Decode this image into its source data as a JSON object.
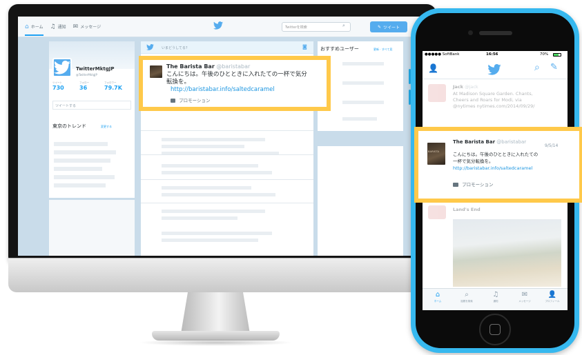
{
  "colors": {
    "twitter_blue": "#55acee",
    "highlight": "#ffc94a",
    "phone_case": "#36b8ef"
  },
  "desktop": {
    "nav": {
      "home": "ホーム",
      "notifications": "通知",
      "messages": "メッセージ"
    },
    "search_placeholder": "Twitterを検索",
    "tweet_button": "ツイート",
    "profile": {
      "name": "TwitterMktgJP",
      "handle": "@TwitterMktgJP",
      "stats": [
        {
          "label": "ツイート",
          "value": "730"
        },
        {
          "label": "フォロー",
          "value": "36"
        },
        {
          "label": "フォロワー",
          "value": "79.7K"
        }
      ],
      "compose_placeholder": "ツイートする"
    },
    "trends": {
      "title": "東京のトレンド",
      "change": "変更する"
    },
    "compose": {
      "placeholder": "いまどうしてる?"
    },
    "who_to_follow": {
      "title": "おすすめユーザー",
      "links": "更新 · すべて見"
    },
    "promo": {
      "name": "The Barista Bar",
      "handle": "@baristabar",
      "text": "こんにちは。午後のひとときに入れたての一杯で気分転換を。",
      "link": "http://baristabar.info/saltedcaramel",
      "label": "プロモーション"
    }
  },
  "phone": {
    "status": {
      "carrier": "●●●●● SoftBank",
      "time": "16:56",
      "battery": "70%"
    },
    "faded_tweet": {
      "name": "Jack",
      "handle": "@jack",
      "line1": "At Madison Square Garden. Chants,",
      "line2": "Cheers and Roars for Modi, via",
      "line3": "@nytimes nytimes.com/2014/09/29/"
    },
    "promo": {
      "name": "The Barista Bar",
      "handle": "@baristabar",
      "date": "9/5/14",
      "line1": "こんにちは。午後のひとときに入れたての",
      "line2": "一杯で気分転換を。",
      "link": "http://baristabar.info/saltedcaramel",
      "label": "プロモーション",
      "thumb_text": "BARISTA"
    },
    "faded_tweet2": {
      "name": "Land's End"
    },
    "tabs": [
      {
        "label": "ホーム"
      },
      {
        "label": "話題を検索"
      },
      {
        "label": "通知"
      },
      {
        "label": "メッセージ"
      },
      {
        "label": "プロフィール"
      }
    ]
  }
}
